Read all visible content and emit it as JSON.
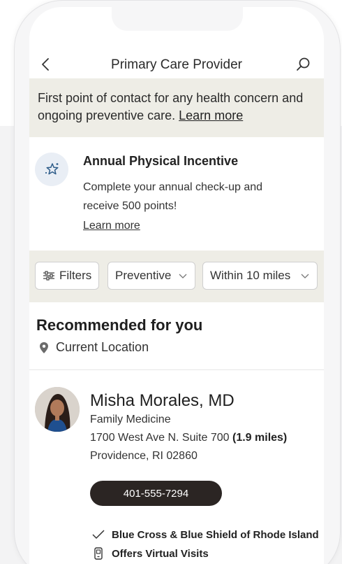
{
  "header": {
    "title": "Primary Care Provider"
  },
  "intro": {
    "text": "First point of contact for any health concern and ongoing preventive care.",
    "link": "Learn more"
  },
  "incentive": {
    "title": "Annual Physical Incentive",
    "description": "Complete your annual check-up and receive 500 points!",
    "link": "Learn more"
  },
  "filters": {
    "filters_label": "Filters",
    "category_value": "Preventive",
    "distance_value": "Within 10 miles"
  },
  "recommended": {
    "title": "Recommended for you",
    "location": "Current Location"
  },
  "provider": {
    "name": "Misha Morales, MD",
    "specialty": "Family Medicine",
    "address": "1700 West Ave N. Suite 700",
    "distance": "(1.9 miles)",
    "city": "Providence, RI 02860",
    "phone": "401-555-7294",
    "insurance": "Blue Cross & Blue Shield of Rhode Island",
    "virtual": "Offers Virtual Visits"
  }
}
